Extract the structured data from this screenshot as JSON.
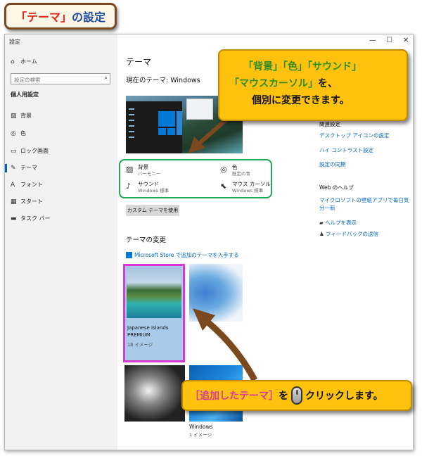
{
  "header": {
    "title_prefix": "「テーマ」",
    "title_rest": "の設定"
  },
  "window": {
    "title": "設定",
    "minimize": "—",
    "maximize": "☐",
    "close": "✕"
  },
  "sidebar": {
    "home": "ホーム",
    "search_placeholder": "設定の検索",
    "section": "個人用設定",
    "items": [
      {
        "label": "背景",
        "icon": "picture-icon"
      },
      {
        "label": "色",
        "icon": "palette-icon"
      },
      {
        "label": "ロック画面",
        "icon": "lock-screen-icon"
      },
      {
        "label": "テーマ",
        "icon": "theme-icon"
      },
      {
        "label": "フォント",
        "icon": "font-icon"
      },
      {
        "label": "スタート",
        "icon": "start-icon"
      },
      {
        "label": "タスク バー",
        "icon": "taskbar-icon"
      }
    ]
  },
  "main": {
    "heading": "テーマ",
    "current_theme": "現在のテーマ: Windows",
    "props": {
      "background": {
        "label": "背景",
        "sub": "ハーモニー"
      },
      "color": {
        "label": "色",
        "sub": "既定の青"
      },
      "sound": {
        "label": "サウンド",
        "sub": "Windows 標準"
      },
      "cursor": {
        "label": "マウス カーソル",
        "sub": "Windows 標準"
      }
    },
    "custom_button": "カスタム テーマを使用",
    "change_heading": "テーマの変更",
    "store_link": "Microsoft Store で追加のテーマを入手する",
    "themes": [
      {
        "name": "Japanese Islands",
        "name2": "PREMIUM",
        "count": "18 イメージ"
      },
      {
        "name": "Windows",
        "count": "1 イメージ"
      }
    ]
  },
  "right_panel": {
    "related_heading": "関連設定",
    "links": [
      "デスクトップ アイコンの設定",
      "ハイ コントラスト設定",
      "設定の同期"
    ],
    "web_help": "Web のヘルプ",
    "web_link": "マイクロソフトの壁紙アプリで毎日気分一新",
    "help": "ヘルプを表示",
    "feedback": "フィードバックの送信"
  },
  "callout1": {
    "line1": "「背景」「色」「サウンド」",
    "line2_green": "「マウスカーソル」",
    "line2_black": "を、",
    "line3": "個別に変更できます。"
  },
  "callout2": {
    "part1": "［追加したテーマ］",
    "part2": "を",
    "part3": "クリックします。"
  },
  "colors": {
    "accent": "#0078d7",
    "link": "#0067c0",
    "callout": "#fdc20e",
    "green": "#1da855",
    "magenta": "#d63ad2",
    "arrow": "#7a4a1e"
  }
}
